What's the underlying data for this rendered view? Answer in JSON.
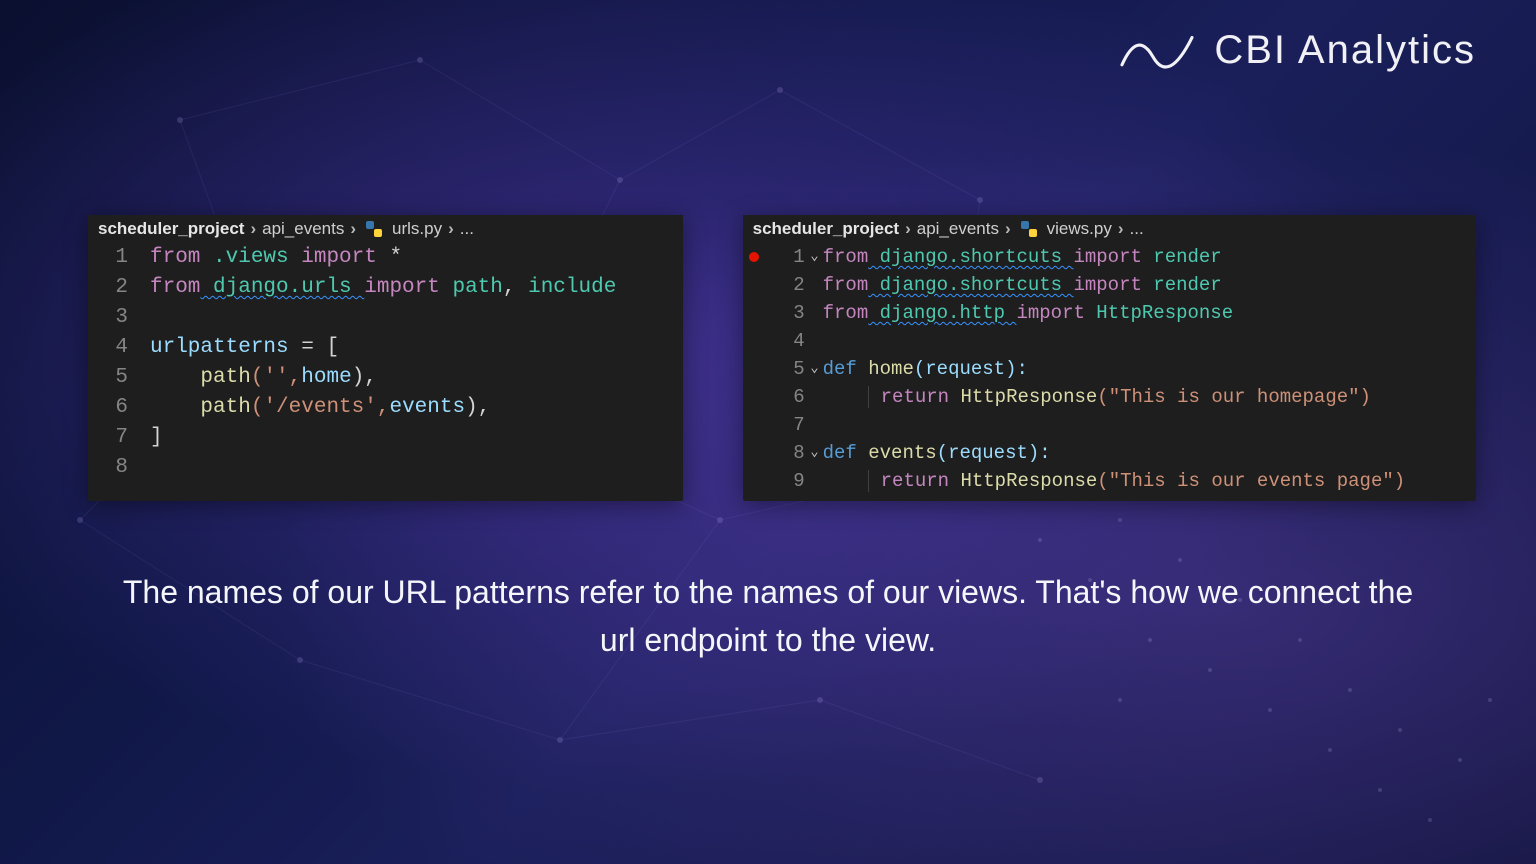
{
  "brand": {
    "name": "CBI Analytics"
  },
  "caption": "The names of our URL patterns refer to the names of our views. That's how we connect the url endpoint to the view.",
  "left": {
    "crumbs": {
      "a": "scheduler_project",
      "b": "api_events",
      "c": "urls.py",
      "d": "..."
    },
    "lines": {
      "l1": "1",
      "l2": "2",
      "l3": "3",
      "l4": "4",
      "l5": "5",
      "l6": "6",
      "l7": "7",
      "l8": "8"
    },
    "t": {
      "from1": "from",
      "dotviews": " .views ",
      "import1": "import",
      "star": " *",
      "from2": "from",
      "djurls": " django.urls ",
      "import2": "import",
      "path": " path",
      "comma1": ",",
      "include": " include",
      "urlpatterns": "urlpatterns",
      "eq": " = ",
      "lbr": "[",
      "pathcall1": "path",
      "args1": "('',",
      "home": "home",
      "close1": "),",
      "pathcall2": "path",
      "args2": "('/events',",
      "events": "events",
      "close2": "),",
      "rbr": "]"
    }
  },
  "right": {
    "crumbs": {
      "a": "scheduler_project",
      "b": "api_events",
      "c": "views.py",
      "d": "..."
    },
    "lines": {
      "l1": "1",
      "l2": "2",
      "l3": "3",
      "l4": "4",
      "l5": "5",
      "l6": "6",
      "l7": "7",
      "l8": "8",
      "l9": "9"
    },
    "t": {
      "from1": "from",
      "mod1": " django.shortcuts ",
      "import1": "import",
      "render1": " render",
      "from2": "from",
      "mod2": " django.shortcuts ",
      "import2": "import",
      "render2": " render",
      "from3": "from",
      "mod3": " django.http ",
      "import3": "import",
      "httpresp": " HttpResponse",
      "def1": "def",
      "home": " home",
      "sig1": "(request):",
      "ret1": "return",
      "call1": " HttpResponse",
      "str1": "(\"This is our homepage\")",
      "def2": "def",
      "events": " events",
      "sig2": "(request):",
      "ret2": "return",
      "call2": " HttpResponse",
      "str2": "(\"This is our events page\")"
    }
  }
}
